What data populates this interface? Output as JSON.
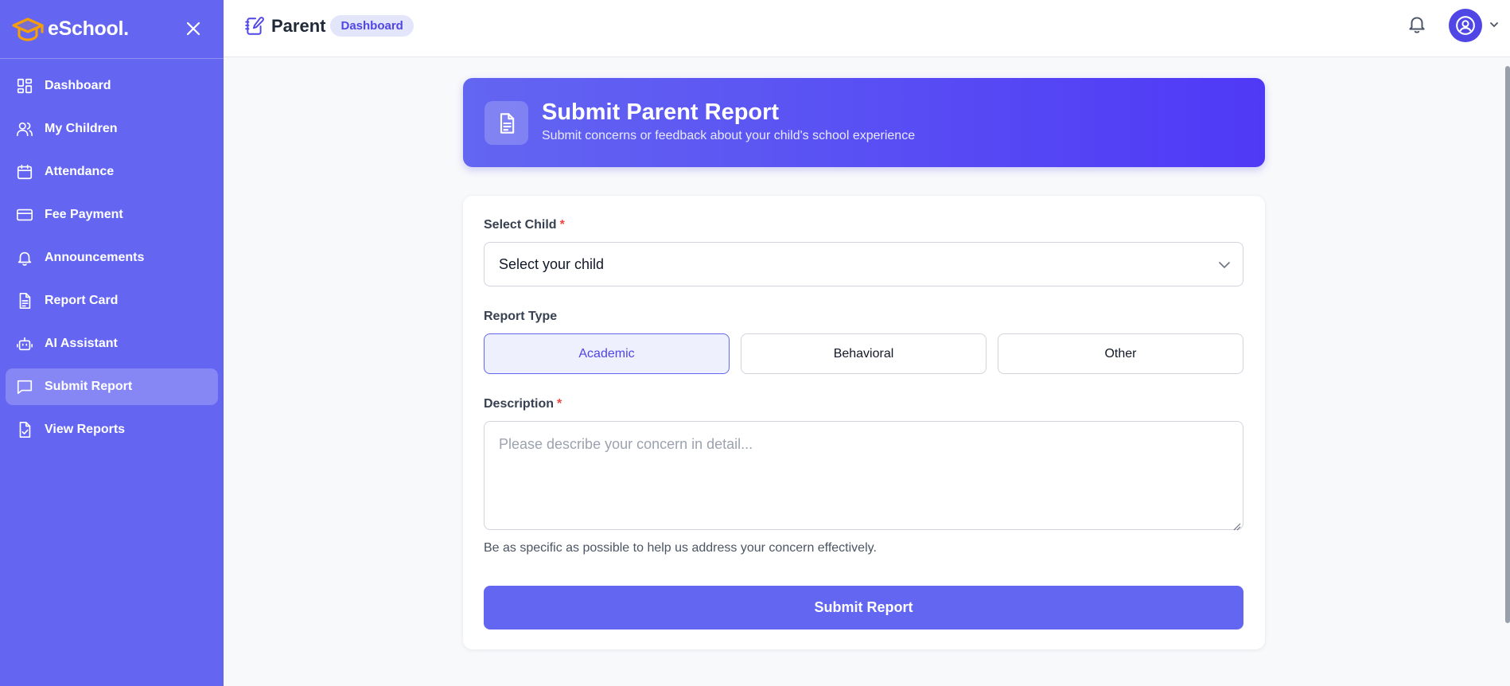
{
  "brand": {
    "name": "eSchool."
  },
  "sidebar": {
    "items": [
      {
        "label": "Dashboard",
        "icon": "grid-icon",
        "active": false
      },
      {
        "label": "My Children",
        "icon": "users-icon",
        "active": false
      },
      {
        "label": "Attendance",
        "icon": "calendar-icon",
        "active": false
      },
      {
        "label": "Fee Payment",
        "icon": "credit-card-icon",
        "active": false
      },
      {
        "label": "Announcements",
        "icon": "bell-icon",
        "active": false
      },
      {
        "label": "Report Card",
        "icon": "document-icon",
        "active": false
      },
      {
        "label": "AI Assistant",
        "icon": "robot-icon",
        "active": false
      },
      {
        "label": "Submit Report",
        "icon": "message-icon",
        "active": true
      },
      {
        "label": "View Reports",
        "icon": "file-check-icon",
        "active": false
      }
    ]
  },
  "topbar": {
    "title": "Parent",
    "badge": "Dashboard"
  },
  "header": {
    "title": "Submit Parent Report",
    "subtitle": "Submit concerns or feedback about your child's school experience"
  },
  "form": {
    "child_label": "Select Child",
    "required_mark": "*",
    "child_value": "Select your child",
    "type_label": "Report Type",
    "types": [
      "Academic",
      "Behavioral",
      "Other"
    ],
    "selected_type": "Academic",
    "description_label": "Description",
    "description_placeholder": "Please describe your concern in detail...",
    "hint": "Be as specific as possible to help us address your concern effectively.",
    "submit_label": "Submit Report"
  },
  "colors": {
    "sidebar": "#6466f1",
    "accent": "#4f46e5",
    "primary_button": "#6366f1",
    "required": "#ef4444",
    "brand_logo": "#f59e0b"
  }
}
